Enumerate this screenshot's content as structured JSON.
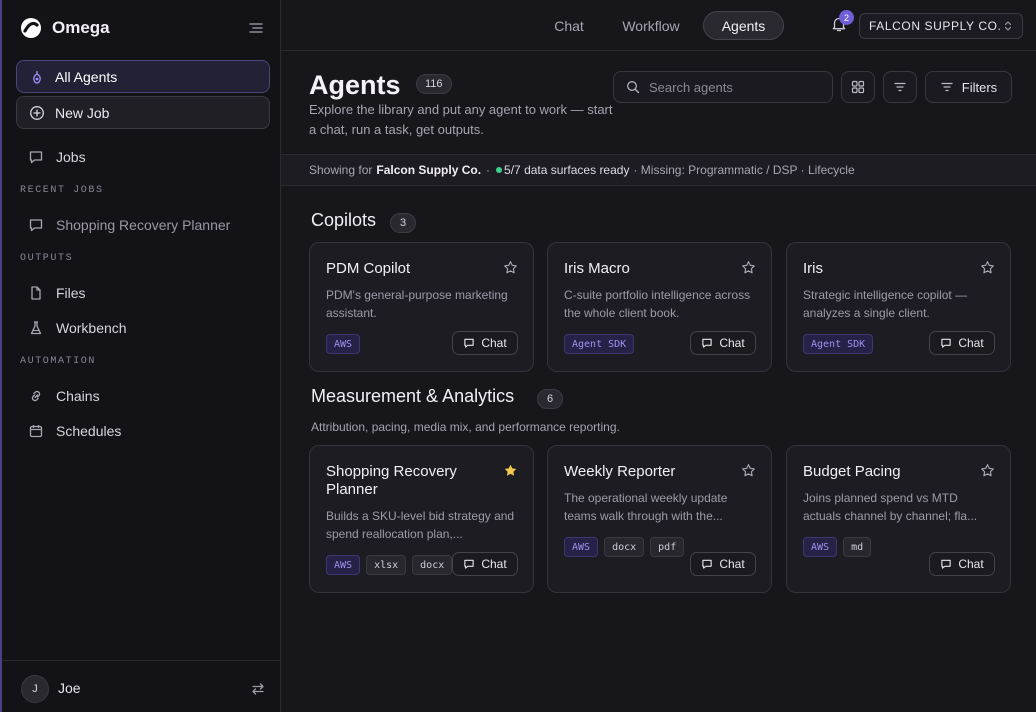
{
  "app": {
    "name": "Omega"
  },
  "sidebar": {
    "all_agents": "All Agents",
    "new_job": "New Job",
    "jobs": "Jobs",
    "recent_jobs_heading": "RECENT JOBS",
    "recent_jobs": [
      "Shopping Recovery Planner"
    ],
    "outputs_heading": "OUTPUTS",
    "files": "Files",
    "workbench": "Workbench",
    "automation_heading": "AUTOMATION",
    "chains": "Chains",
    "schedules": "Schedules",
    "user": {
      "initial": "J",
      "name": "Joe"
    }
  },
  "topbar": {
    "tabs": [
      "Chat",
      "Workflow",
      "Agents"
    ],
    "active_tab": "Agents",
    "notifications": "2",
    "org": "FALCON SUPPLY CO."
  },
  "header": {
    "title": "Agents",
    "count": "116",
    "description": "Explore the library and put any agent to work — start a chat, run a task, get outputs.",
    "search_placeholder": "Search agents",
    "filters_label": "Filters"
  },
  "status": {
    "prefix": "Showing for",
    "org": "Falcon Supply Co.",
    "separator": "·",
    "ready": "5/7 data surfaces ready",
    "missing": "· Missing: Programmatic / DSP · Lifecycle"
  },
  "sections": [
    {
      "title": "Copilots",
      "count": "3",
      "description": "",
      "cards": [
        {
          "title": "PDM Copilot",
          "description": "PDM's general-purpose marketing assistant.",
          "tags": [
            "AWS"
          ],
          "starred": false,
          "chat": "Chat"
        },
        {
          "title": "Iris Macro",
          "description": "C-suite portfolio intelligence across the whole client book.",
          "tags": [
            "Agent SDK"
          ],
          "starred": false,
          "chat": "Chat"
        },
        {
          "title": "Iris",
          "description": "Strategic intelligence copilot — analyzes a single client.",
          "tags": [
            "Agent SDK"
          ],
          "starred": false,
          "chat": "Chat"
        }
      ]
    },
    {
      "title": "Measurement & Analytics",
      "count": "6",
      "description": "Attribution, pacing, media mix, and performance reporting.",
      "cards": [
        {
          "title": "Shopping Recovery Planner",
          "description": "Builds a SKU-level bid strategy and spend reallocation plan,...",
          "tags": [
            "AWS",
            "xlsx",
            "docx"
          ],
          "starred": true,
          "chat": "Chat"
        },
        {
          "title": "Weekly Reporter",
          "description": "The operational weekly update teams walk through with the...",
          "tags": [
            "AWS",
            "docx",
            "pdf"
          ],
          "starred": false,
          "chat": "Chat"
        },
        {
          "title": "Budget Pacing",
          "description": "Joins planned spend vs MTD actuals channel by channel; fla...",
          "tags": [
            "AWS",
            "md"
          ],
          "starred": false,
          "chat": "Chat"
        }
      ]
    }
  ],
  "colors": {
    "accent": "#6d5fd8",
    "ready_dot": "#3fcf8e",
    "star_on": "#f2c94c"
  },
  "icons": {
    "logo": "omega-logo-icon",
    "collapse": "collapse-sidebar-icon",
    "agents": "agents-icon",
    "new_job": "plus-circle-icon",
    "jobs": "chat-bubble-icon",
    "files": "file-icon",
    "workbench": "flask-icon",
    "chains": "link-icon",
    "schedules": "calendar-icon",
    "switch": "switch-arrows-icon",
    "bell": "bell-icon",
    "search": "search-icon",
    "grid": "grid-view-icon",
    "sort": "sort-icon",
    "filters": "filter-icon",
    "star": "star-icon"
  }
}
